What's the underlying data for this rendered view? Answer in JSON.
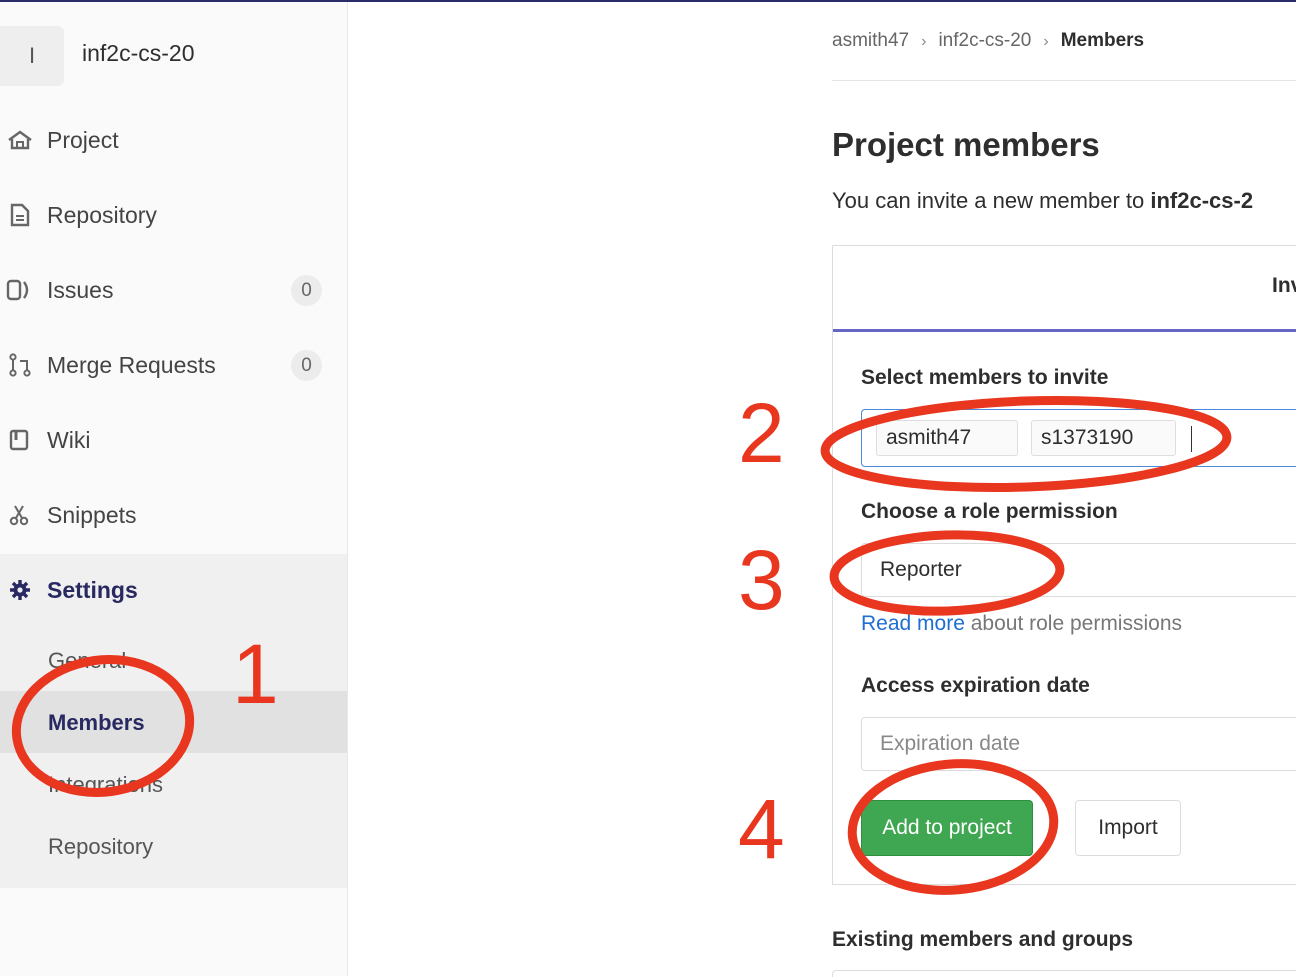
{
  "sidebar": {
    "project_avatar_letter": "I",
    "project_name": "inf2c-cs-20",
    "items": [
      {
        "label": "Project",
        "icon": "home-icon"
      },
      {
        "label": "Repository",
        "icon": "file-icon"
      },
      {
        "label": "Issues",
        "icon": "issues-icon",
        "count": "0"
      },
      {
        "label": "Merge Requests",
        "icon": "merge-request-icon",
        "count": "0"
      },
      {
        "label": "Wiki",
        "icon": "book-icon"
      },
      {
        "label": "Snippets",
        "icon": "scissors-icon"
      },
      {
        "label": "Settings",
        "icon": "gear-icon",
        "active": true
      }
    ],
    "settings_sub": [
      {
        "label": "General"
      },
      {
        "label": "Members",
        "active": true
      },
      {
        "label": "Integrations"
      },
      {
        "label": "Repository"
      }
    ]
  },
  "breadcrumb": {
    "items": [
      "asmith47",
      "inf2c-cs-20",
      "Members"
    ],
    "separator": "›"
  },
  "main": {
    "title": "Project members",
    "invite_prefix": "You can invite a new member to ",
    "invite_project": "inf2c-cs-2",
    "tab_label": "Inv",
    "select_members_label": "Select members to invite",
    "tokens": [
      "asmith47",
      "s1373190"
    ],
    "role_label": "Choose a role permission",
    "role_value": "Reporter",
    "help_link": "Read more",
    "help_text": " about role permissions",
    "expiration_label": "Access expiration date",
    "expiration_placeholder": "Expiration date",
    "add_button": "Add to project",
    "import_button": "Import",
    "existing_heading": "Existing members and groups"
  },
  "annotations": {
    "color": "#e8361f",
    "steps": [
      "1",
      "2",
      "3",
      "4"
    ]
  },
  "colors": {
    "accent": "#292961",
    "primary_button": "#3fa651",
    "link": "#1f6fd1",
    "focus_border": "#4b89dc",
    "tab_underline": "#6666c4"
  }
}
